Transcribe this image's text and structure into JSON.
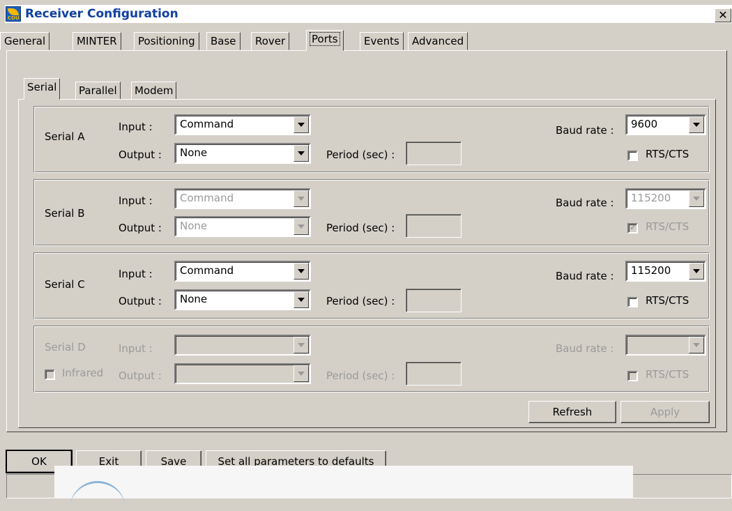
{
  "window": {
    "title": "Receiver Configuration",
    "close_glyph": "✕",
    "icon_text": "CDU",
    "icon": "cdu-app-icon"
  },
  "tabs": [
    "General",
    "MINTER",
    "Positioning",
    "Base",
    "Rover",
    "Ports",
    "Events",
    "Advanced"
  ],
  "active_tab": "Ports",
  "subtabs": [
    "Serial",
    "Parallel",
    "Modem"
  ],
  "active_subtab": "Serial",
  "labels": {
    "input": "Input :",
    "output": "Output :",
    "period": "Period (sec) :",
    "baud": "Baud rate :",
    "rts": "RTS/CTS"
  },
  "serial": [
    {
      "name": "Serial A",
      "input": "Command",
      "output": "None",
      "period": "",
      "baud": "9600",
      "rts": false,
      "enabled": true
    },
    {
      "name": "Serial B",
      "input": "Command",
      "output": "None",
      "period": "",
      "baud": "115200",
      "rts": true,
      "enabled": false
    },
    {
      "name": "Serial C",
      "input": "Command",
      "output": "None",
      "period": "",
      "baud": "115200",
      "rts": false,
      "enabled": true
    },
    {
      "name": "Serial D",
      "infrared_label": "Infrared",
      "input": "",
      "output": "",
      "period": "",
      "baud": "",
      "rts": false,
      "enabled": false
    }
  ],
  "buttons": {
    "refresh": "Refresh",
    "apply": "Apply",
    "ok": "OK",
    "exit": "Exit",
    "save": "Save",
    "defaults": "Set all parameters to defaults"
  },
  "colors": {
    "face": "#d4d0c8",
    "title_text": "#1040a0",
    "disabled_text": "#9a9a9a"
  }
}
